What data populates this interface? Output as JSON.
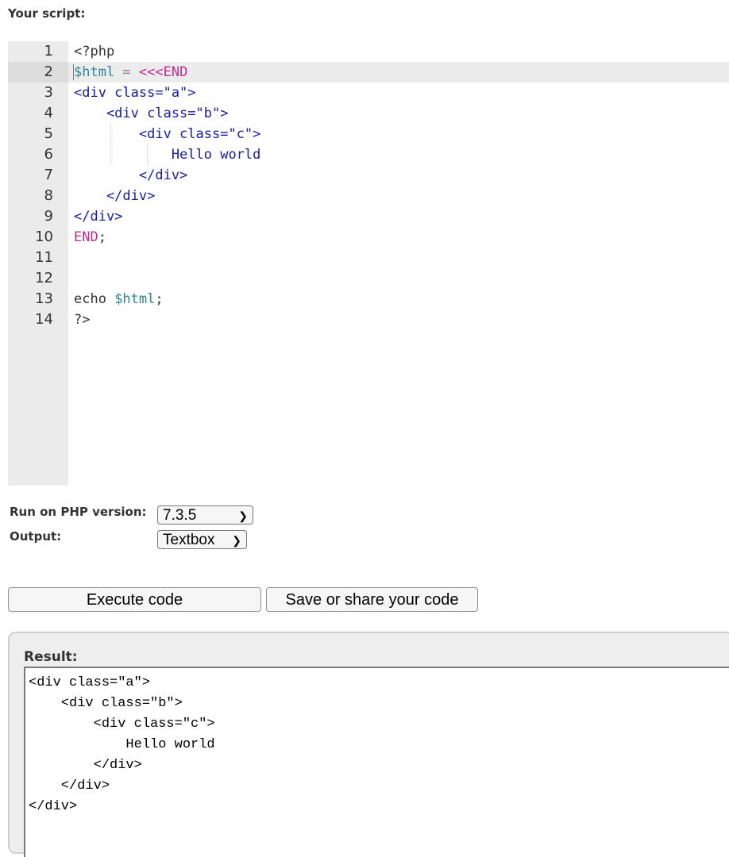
{
  "heading": "Your script:",
  "editor": {
    "active_line": 2,
    "lines": [
      {
        "num": "1",
        "tokens": [
          {
            "t": "<?php",
            "c": "plain"
          }
        ]
      },
      {
        "num": "2",
        "tokens": [
          {
            "t": "$html",
            "c": "var"
          },
          {
            "t": " = ",
            "c": "op"
          },
          {
            "t": "<<<END",
            "c": "kw"
          }
        ]
      },
      {
        "num": "3",
        "tokens": [
          {
            "t": "<div class=\"a\">",
            "c": "tag"
          }
        ]
      },
      {
        "num": "4",
        "tokens": [
          {
            "t": "    <div class=\"b\">",
            "c": "tag"
          }
        ]
      },
      {
        "num": "5",
        "tokens": [
          {
            "t": "        <div class=\"c\">",
            "c": "tag"
          }
        ]
      },
      {
        "num": "6",
        "tokens": [
          {
            "t": "            Hello world",
            "c": "tag"
          }
        ]
      },
      {
        "num": "7",
        "tokens": [
          {
            "t": "        </div>",
            "c": "tag"
          }
        ]
      },
      {
        "num": "8",
        "tokens": [
          {
            "t": "    </div>",
            "c": "tag"
          }
        ]
      },
      {
        "num": "9",
        "tokens": [
          {
            "t": "</div>",
            "c": "tag"
          }
        ]
      },
      {
        "num": "10",
        "tokens": [
          {
            "t": "END",
            "c": "kw"
          },
          {
            "t": ";",
            "c": "plain"
          }
        ]
      },
      {
        "num": "11",
        "tokens": []
      },
      {
        "num": "12",
        "tokens": []
      },
      {
        "num": "13",
        "tokens": [
          {
            "t": "echo ",
            "c": "plain"
          },
          {
            "t": "$html",
            "c": "var"
          },
          {
            "t": ";",
            "c": "plain"
          }
        ]
      },
      {
        "num": "14",
        "tokens": [
          {
            "t": "?>",
            "c": "plain"
          }
        ]
      }
    ]
  },
  "form": {
    "php_version_label": "Run on PHP version:",
    "php_version_value": "7.3.5",
    "output_label": "Output:",
    "output_value": "Textbox",
    "chevron": "chevron-down-icon"
  },
  "buttons": {
    "execute": "Execute code",
    "save": "Save or share your code"
  },
  "result": {
    "label": "Result:",
    "text": "<div class=\"a\">\n    <div class=\"b\">\n        <div class=\"c\">\n            Hello world\n        </div>\n    </div>\n</div>"
  }
}
